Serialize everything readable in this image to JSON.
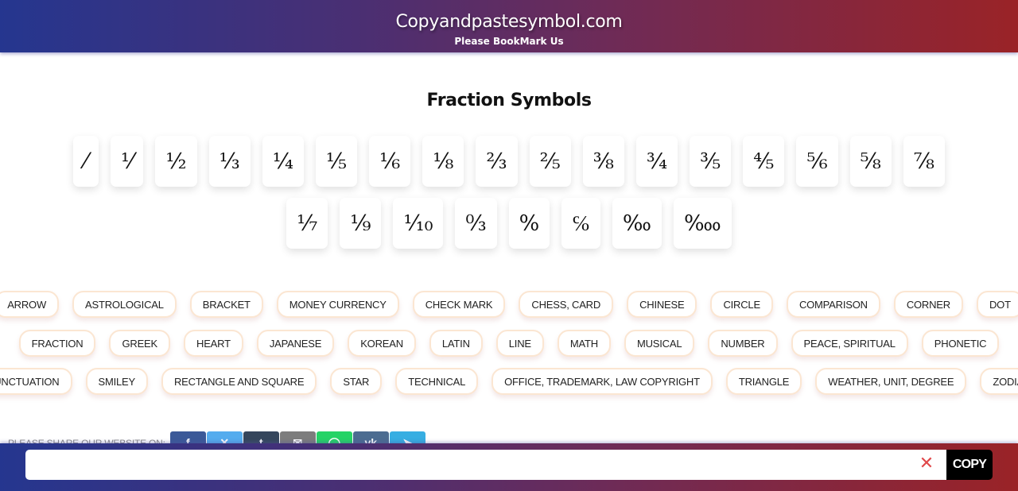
{
  "header": {
    "title": "Copyandpastesymbol.com",
    "tagline": "Please BookMark Us"
  },
  "page_title": "Fraction Symbols",
  "symbols": {
    "row1": [
      "⁄",
      "⅟",
      "½",
      "⅓",
      "¼",
      "⅕",
      "⅙",
      "⅛",
      "⅔",
      "⅖",
      "⅜",
      "¾",
      "⅗",
      "⅘",
      "⅚",
      "⅝",
      "⅞"
    ],
    "row2": [
      "⅐",
      "⅑",
      "⅒",
      "↉",
      "%",
      "℅",
      "‰",
      "‱"
    ]
  },
  "categories": {
    "row1": [
      "ARROW",
      "ASTROLOGICAL",
      "BRACKET",
      "MONEY CURRENCY",
      "CHECK MARK",
      "CHESS, CARD",
      "CHINESE",
      "CIRCLE",
      "COMPARISON",
      "CORNER",
      "DOT"
    ],
    "row2": [
      "FRACTION",
      "GREEK",
      "HEART",
      "JAPANESE",
      "KOREAN",
      "LATIN",
      "LINE",
      "MATH",
      "MUSICAL",
      "NUMBER",
      "PEACE, SPIRITUAL",
      "PHONETIC"
    ],
    "row3": [
      "PUNCTUATION",
      "SMILEY",
      "RECTANGLE AND SQUARE",
      "STAR",
      "TECHNICAL",
      "OFFICE, TRADEMARK, LAW COPYRIGHT",
      "TRIANGLE",
      "WEATHER, UNIT, DEGREE",
      "ZODIAC"
    ]
  },
  "share": {
    "label": "PLEASE SHARE OUR WEBSITE ON:",
    "buttons": [
      {
        "name": "facebook",
        "glyph": "f",
        "color": "#3b5998"
      },
      {
        "name": "twitter",
        "glyph": "✕",
        "color": "#55acee"
      },
      {
        "name": "tumblr",
        "glyph": "t",
        "color": "#35465c"
      },
      {
        "name": "email",
        "glyph": "✉",
        "color": "#7d7d7d"
      },
      {
        "name": "whatsapp",
        "glyph": "◯",
        "color": "#25d366"
      },
      {
        "name": "vk",
        "glyph": "vk",
        "color": "#4c6c91"
      },
      {
        "name": "telegram",
        "glyph": "➤",
        "color": "#37aee2"
      }
    ]
  },
  "copybar": {
    "input_value": "",
    "clear_glyph": "✕",
    "copy_label": "COPY"
  }
}
